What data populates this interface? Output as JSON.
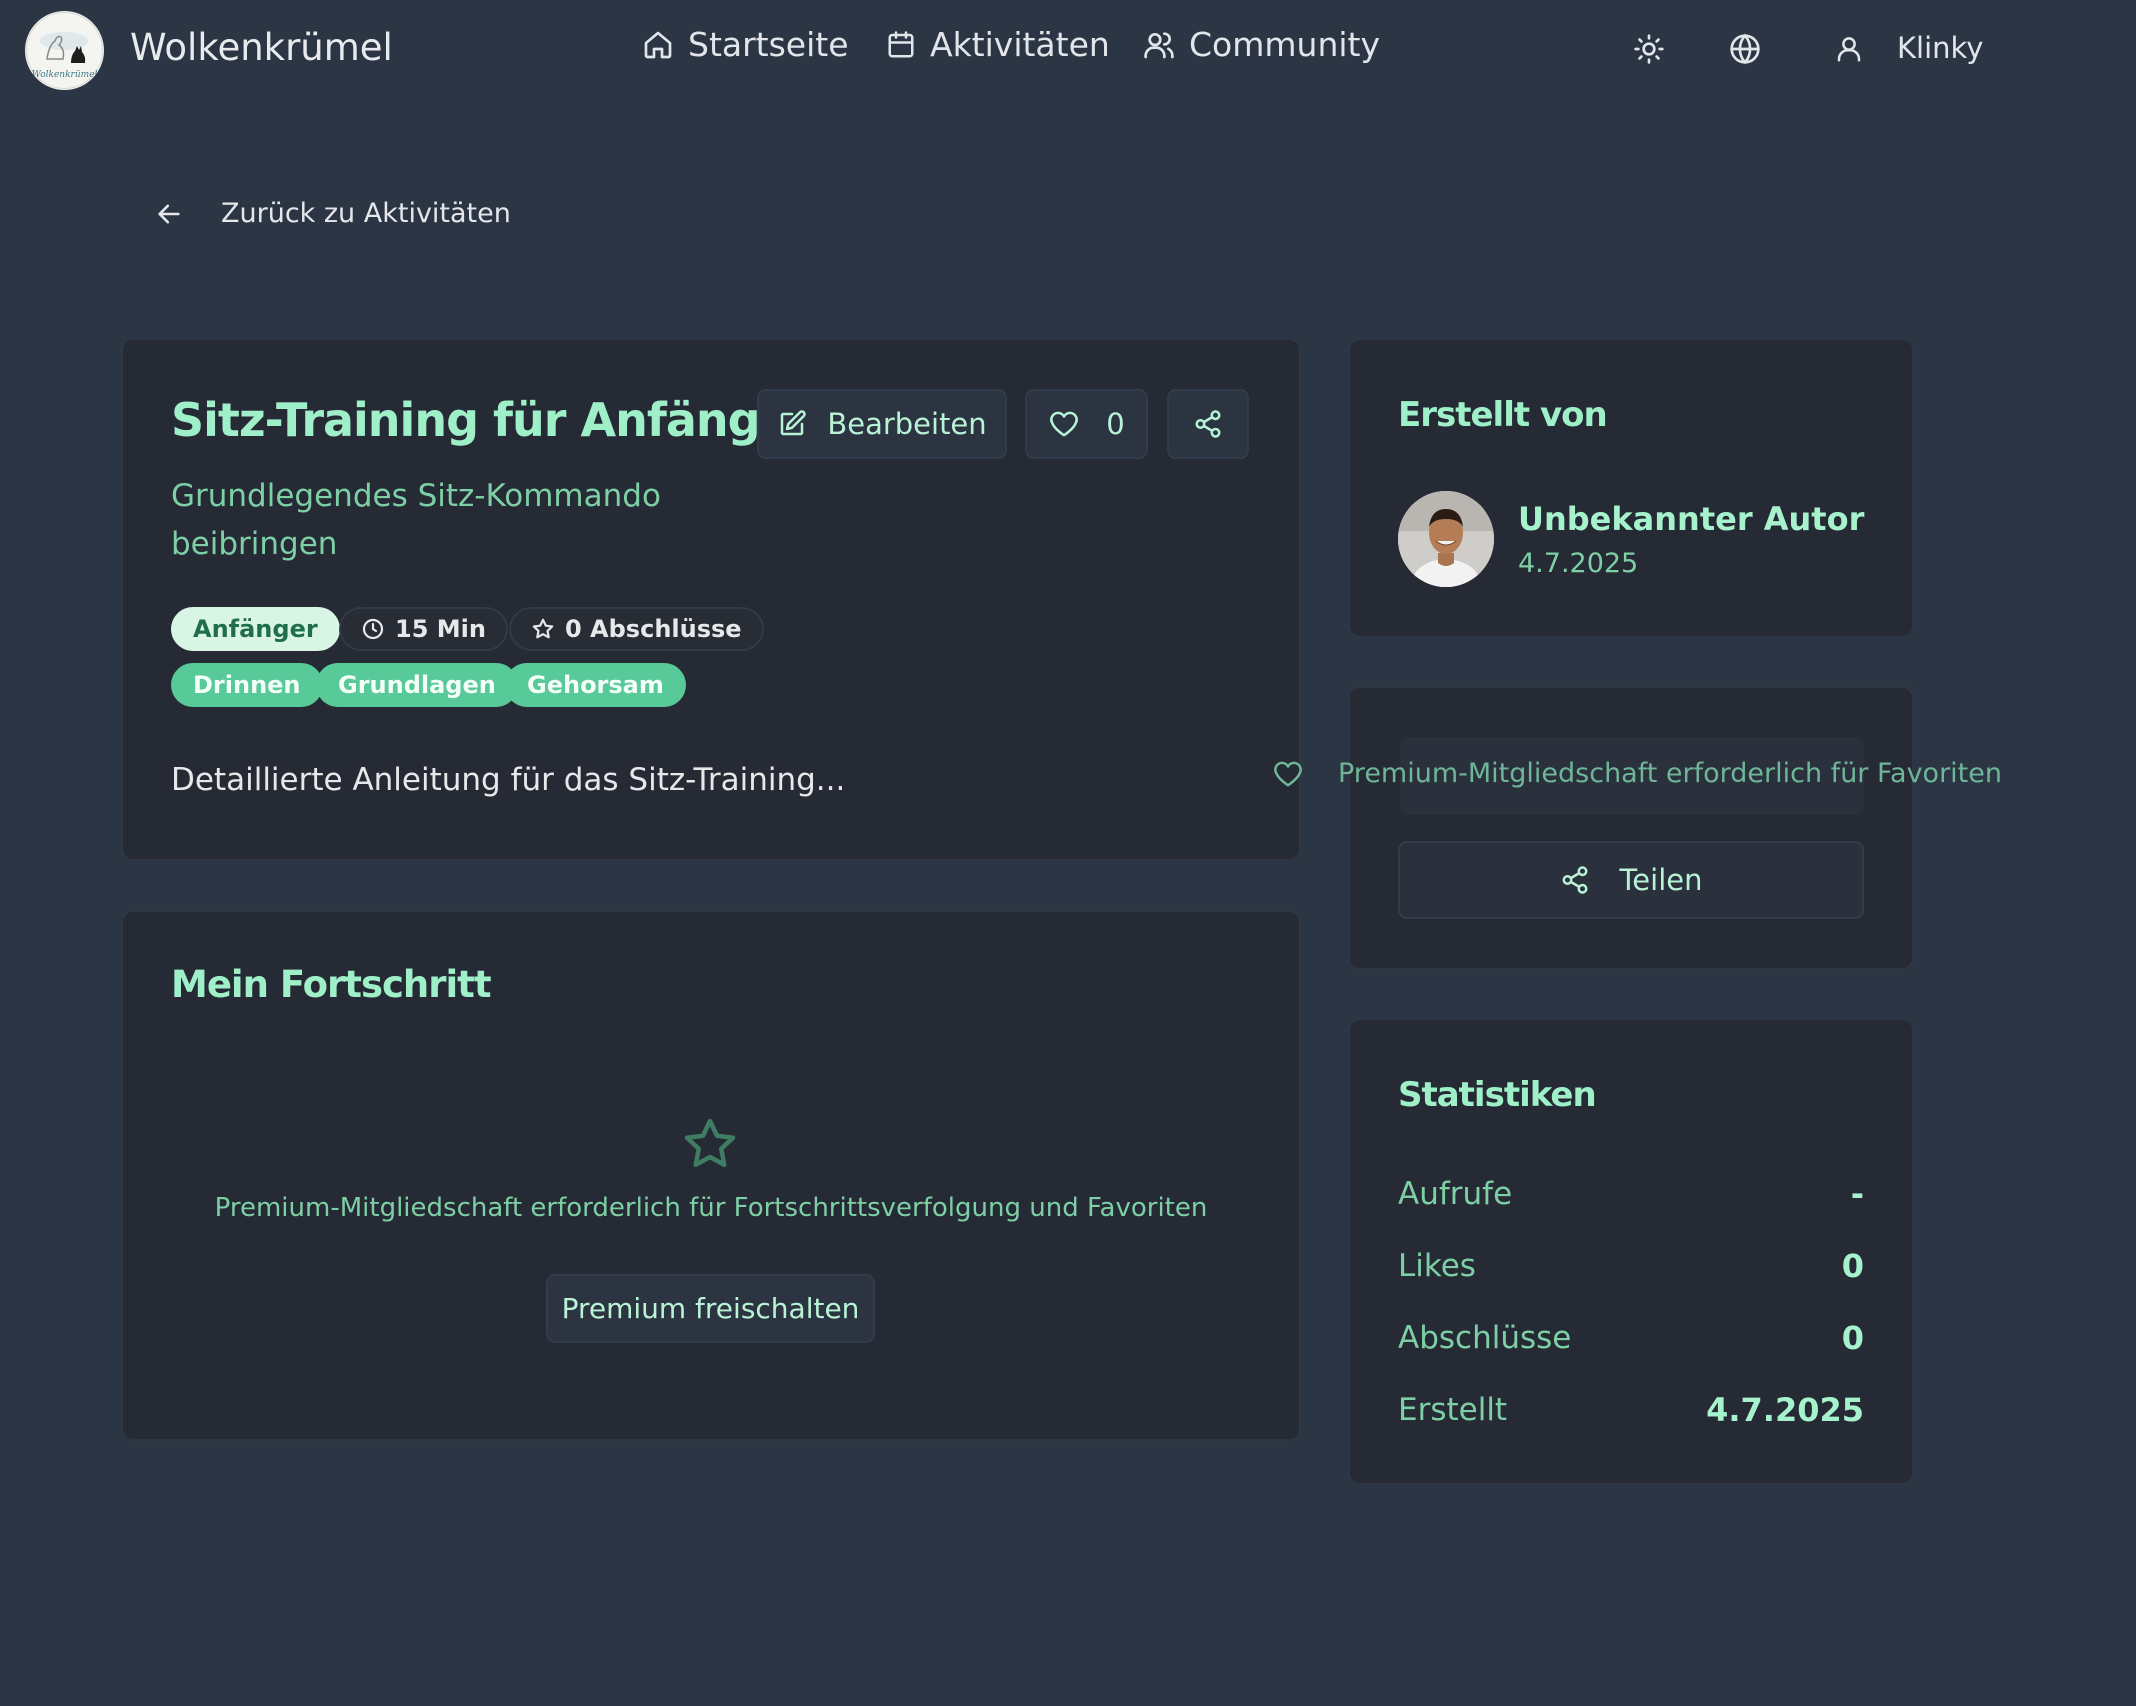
{
  "header": {
    "brand": "Wolkenkrümel",
    "logo_text": "Wolkenkrümel",
    "nav": [
      {
        "label": "Startseite",
        "icon": "home-icon"
      },
      {
        "label": "Aktivitäten",
        "icon": "calendar-icon"
      },
      {
        "label": "Community",
        "icon": "users-icon"
      }
    ],
    "user_name": "Klinky"
  },
  "back_link": "Zurück zu Aktivitäten",
  "activity": {
    "title": "Sitz-Training für Anfänger",
    "subtitle": "Grundlegendes Sitz-Kommando beibringen",
    "edit_label": "Bearbeiten",
    "like_count": "0",
    "level": "Anfänger",
    "duration": "15 Min",
    "completions": "0 Abschlüsse",
    "tags": [
      "Drinnen",
      "Grundlagen",
      "Gehorsam"
    ],
    "description": "Detaillierte Anleitung für das Sitz-Training..."
  },
  "progress": {
    "title": "Mein Fortschritt",
    "message": "Premium-Mitgliedschaft erforderlich für Fortschrittsverfolgung und Favoriten",
    "button": "Premium freischalten"
  },
  "author": {
    "title": "Erstellt von",
    "name": "Unbekannter Autor",
    "date": "4.7.2025"
  },
  "actions": {
    "favorite_message": "Premium-Mitgliedschaft erforderlich für Favoriten",
    "share_label": "Teilen"
  },
  "stats": {
    "title": "Statistiken",
    "rows": [
      {
        "label": "Aufrufe",
        "value": "-"
      },
      {
        "label": "Likes",
        "value": "0"
      },
      {
        "label": "Abschlüsse",
        "value": "0"
      },
      {
        "label": "Erstellt",
        "value": "4.7.2025"
      }
    ]
  },
  "colors": {
    "background": "#2b3544",
    "card": "#252a34",
    "accent": "#9ff0c9",
    "accent_muted": "#7dcfa5",
    "tag_green": "#58c998"
  }
}
